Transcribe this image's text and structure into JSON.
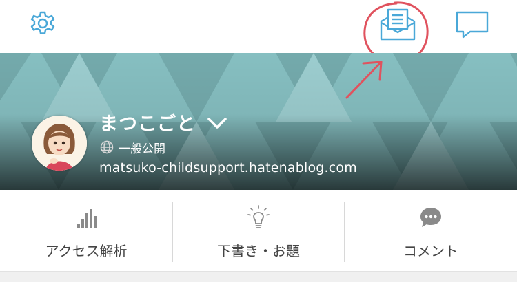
{
  "header": {
    "settings_icon": "gear-icon",
    "inbox_icon": "envelope-letter-icon",
    "comments_icon": "speech-bubble-icon"
  },
  "blog": {
    "title": "まつこごと",
    "visibility": "一般公開",
    "url": "matsuko-childsupport.hatenablog.com"
  },
  "tabs": [
    {
      "label": "アクセス解析",
      "icon": "bar-chart-icon"
    },
    {
      "label": "下書き・お題",
      "icon": "lightbulb-icon"
    },
    {
      "label": "コメント",
      "icon": "chat-bubble-icon"
    }
  ],
  "colors": {
    "accent": "#4aa8d8",
    "annotation": "#e0525e",
    "banner": "#7fb3b5",
    "tab_icon": "#8a8a8a",
    "tab_text": "#444444"
  }
}
